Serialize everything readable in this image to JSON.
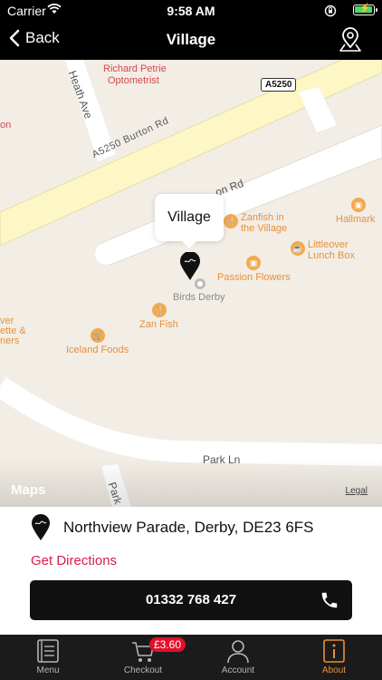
{
  "status_bar": {
    "carrier": "Carrier",
    "time": "9:58 AM"
  },
  "nav": {
    "back_label": "Back",
    "title": "Village"
  },
  "map": {
    "callout": "Village",
    "roads": {
      "burton_rd": "A5250   Burton Rd",
      "shield": "A5250",
      "heath_ave": "Heath Ave",
      "lunch_rd": "on Rd",
      "park_ln": "Park Ln",
      "park_ln_vertical": "Park"
    },
    "places": {
      "optometrist_1": "Richard Petrie",
      "optometrist_2": "Optometrist",
      "zanfish_village_1": "Zanfish in",
      "zanfish_village_2": "the Village",
      "hallmark": "Hallmark",
      "littleover_1": "Littleover",
      "littleover_2": "Lunch Box",
      "passion_flowers": "Passion Flowers",
      "birds_derby": "Birds Derby",
      "zan_fish": "Zan Fish",
      "iceland": "Iceland Foods",
      "left_1": "on",
      "left_2": "ver",
      "left_3": "ette &",
      "left_4": "ners"
    },
    "maps_logo": "Maps",
    "legal": "Legal"
  },
  "info": {
    "address": "Northview Parade, Derby, DE23 6FS",
    "directions": "Get Directions",
    "phone": "01332 768 427"
  },
  "tabbar": {
    "menu": "Menu",
    "checkout": "Checkout",
    "cart_total": "£3.60",
    "account": "Account",
    "about": "About"
  },
  "colors": {
    "accent": "#e8903a",
    "directions": "#d81b4a",
    "badge": "#e0102a",
    "battery": "#4cd964"
  }
}
